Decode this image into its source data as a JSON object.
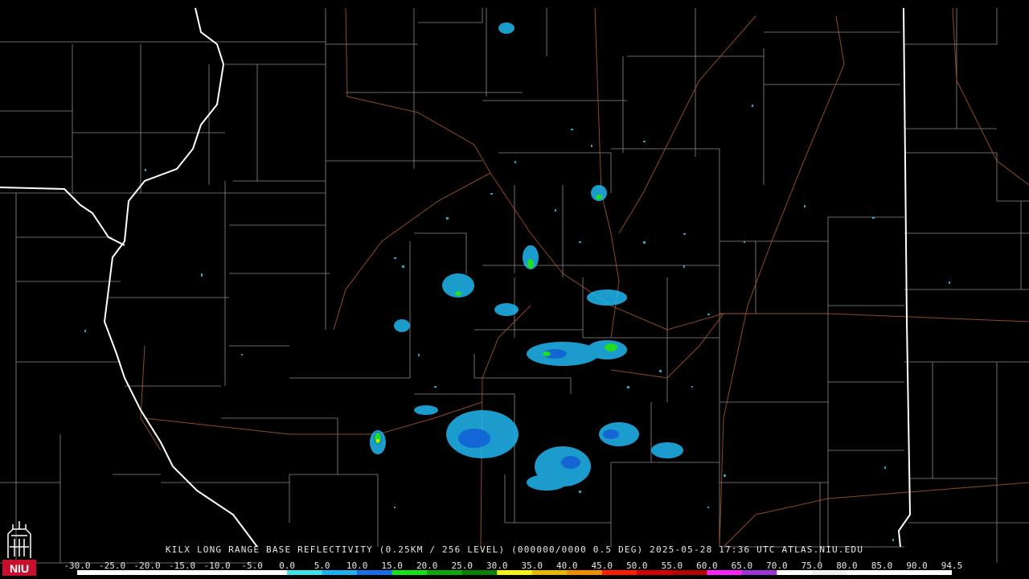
{
  "title": "KILX LONG RANGE BASE REFLECTIVITY (0.25KM / 256 LEVEL) (000000/0000 0.5 DEG) 2025-05-28 17:36 UTC  ATLAS.NIU.EDU",
  "scale": {
    "labels": [
      "-30.0",
      "-25.0",
      "-20.0",
      "-15.0",
      "-10.0",
      "-5.0",
      "0.0",
      "5.0",
      "10.0",
      "15.0",
      "20.0",
      "25.0",
      "30.0",
      "35.0",
      "40.0",
      "45.0",
      "50.0",
      "55.0",
      "60.0",
      "65.0",
      "70.0",
      "75.0",
      "80.0",
      "85.0",
      "90.0",
      "94.5"
    ],
    "colors": [
      "#ffffff",
      "#ffffff",
      "#ffffff",
      "#ffffff",
      "#ffffff",
      "#ffffff",
      "#3ce6e6",
      "#1fb0f0",
      "#1570e8",
      "#14e214",
      "#0ca80c",
      "#068006",
      "#f5f514",
      "#e6b800",
      "#f08c00",
      "#ff1a00",
      "#d20000",
      "#b40000",
      "#ff22ff",
      "#9e33d6",
      "#ffffff",
      "#f0f0f0",
      "#ffffff",
      "#ffffff",
      "#ffffff"
    ]
  },
  "logo": {
    "text": "NIU",
    "color": "#c8102e"
  },
  "map": {
    "state_boundary_color": "#ffffff",
    "county_line_color": "#8a8a8a",
    "road_color": "#a0522d",
    "background": "#000000"
  }
}
